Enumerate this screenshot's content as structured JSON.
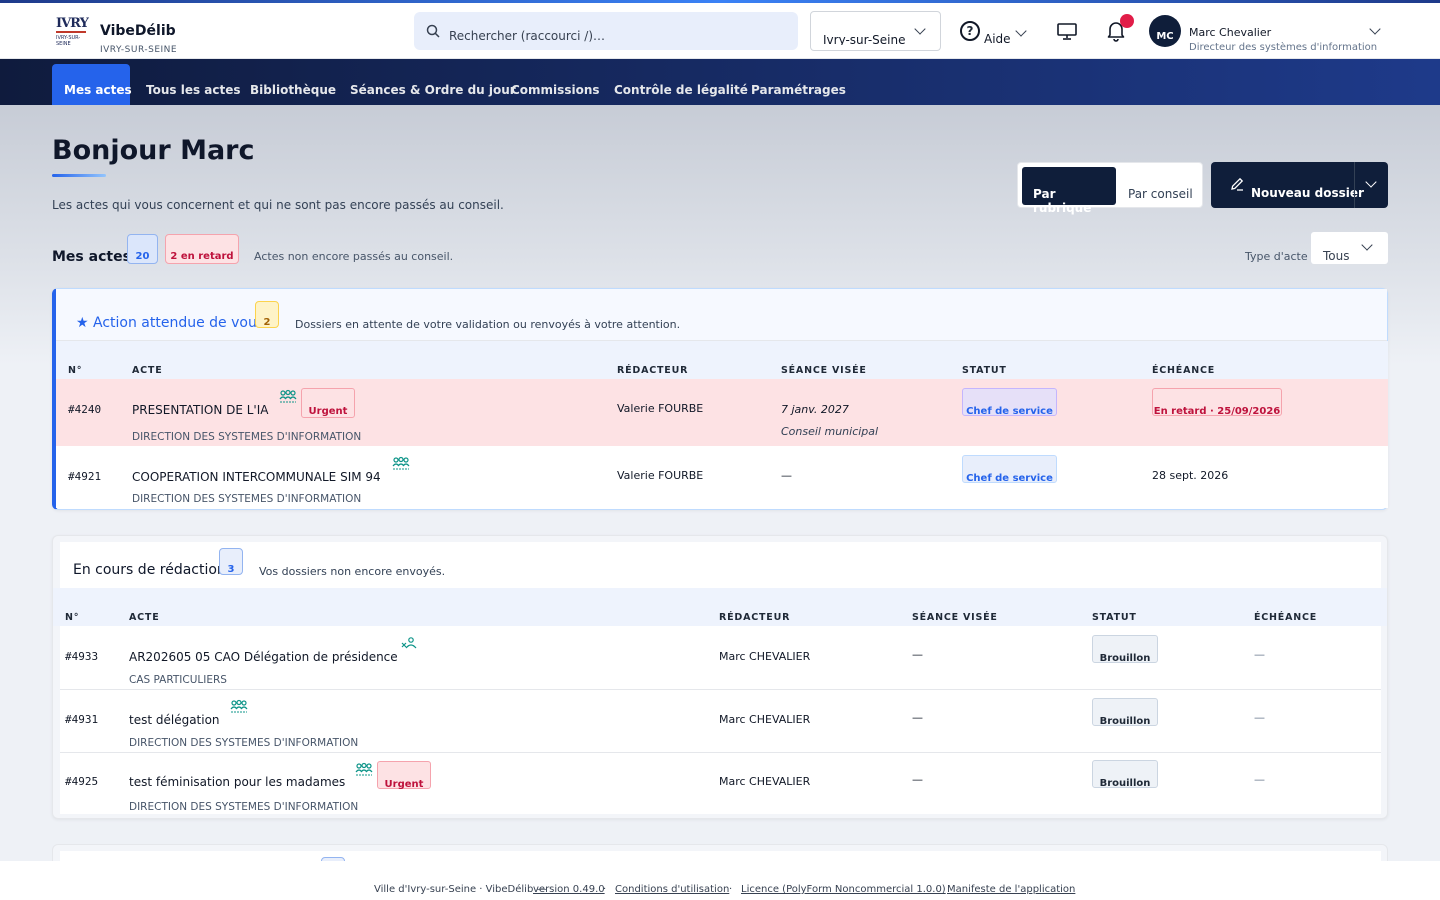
{
  "brand": {
    "logo_top": "IVRY",
    "logo_bottom": "IVRY-SUR-SEINE",
    "name": "VibeDélib",
    "sub": "IVRY-SUR-SEINE"
  },
  "search": {
    "placeholder": "Rechercher (raccourci /)…"
  },
  "city_select": {
    "value": "Ivry-sur-Seine"
  },
  "help": {
    "label": "Aide"
  },
  "user": {
    "initials": "MC",
    "name": "Marc Chevalier",
    "role": "Directeur des systèmes d'information"
  },
  "nav": {
    "items": [
      {
        "label": "Mes actes"
      },
      {
        "label": "Tous les actes"
      },
      {
        "label": "Bibliothèque"
      },
      {
        "label": "Séances & Ordre du jour"
      },
      {
        "label": "Commissions"
      },
      {
        "label": "Contrôle de légalité"
      },
      {
        "label": "Paramétrages"
      }
    ]
  },
  "hero": {
    "greeting": "Bonjour Marc",
    "subtitle": "Les actes qui vous concernent et qui ne sont pas encore passés au conseil.",
    "toggle": {
      "active": "Par rubrique",
      "inactive": "Par conseil"
    },
    "new_button": "Nouveau dossier"
  },
  "mes_actes": {
    "title": "Mes actes",
    "count": "20",
    "late_badge": "2 en retard",
    "subtitle": "Actes non encore passés au conseil.",
    "type_label": "Type d'acte",
    "type_value": "Tous"
  },
  "columns": {
    "num": "N°",
    "acte": "ACTE",
    "redacteur": "RÉDACTEUR",
    "seance": "SÉANCE VISÉE",
    "statut": "STATUT",
    "echeance": "ÉCHÉANCE"
  },
  "action": {
    "title": "★ Action attendue de vous",
    "count": "2",
    "subtitle": "Dossiers en attente de votre validation ou renvoyés à votre attention.",
    "rows": [
      {
        "num": "#4240",
        "title": "PRESENTATION DE L'IA",
        "urgent": "Urgent",
        "service": "DIRECTION DES SYSTEMES D'INFORMATION",
        "redacteur": "Valerie FOURBE",
        "seance_date": "7 janv. 2027",
        "seance_name": "Conseil municipal",
        "statut": "Chef de service",
        "echeance": "En retard · 25/09/2026"
      },
      {
        "num": "#4921",
        "title": "COOPERATION INTERCOMMUNALE SIM 94",
        "service": "DIRECTION DES SYSTEMES D'INFORMATION",
        "redacteur": "Valerie FOURBE",
        "seance_date": "—",
        "statut": "Chef de service",
        "echeance": "28 sept. 2026"
      }
    ]
  },
  "redaction": {
    "title": "En cours de rédaction",
    "count": "3",
    "subtitle": "Vos dossiers non encore envoyés.",
    "rows": [
      {
        "num": "#4933",
        "title": "AR202605 05 CAO Délégation de présidence",
        "service": "CAS PARTICULIERS",
        "redacteur": "Marc CHEVALIER",
        "seance": "—",
        "statut": "Brouillon",
        "echeance": "—"
      },
      {
        "num": "#4931",
        "title": "test délégation",
        "service": "DIRECTION DES SYSTEMES D'INFORMATION",
        "redacteur": "Marc CHEVALIER",
        "seance": "—",
        "statut": "Brouillon",
        "echeance": "—"
      },
      {
        "num": "#4925",
        "title": "test féminisation pour les madames",
        "urgent": "Urgent",
        "service": "DIRECTION DES SYSTEMES D'INFORMATION",
        "redacteur": "Marc CHEVALIER",
        "seance": "—",
        "statut": "Brouillon",
        "echeance": "—"
      }
    ]
  },
  "footer": {
    "text": "Ville d'Ivry-sur-Seine · VibeDélib —",
    "version": "version 0.49.0",
    "sep": "·",
    "cgu": "Conditions d'utilisation",
    "licence": "Licence (PolyForm Noncommercial 1.0.0)",
    "manifeste": "Manifeste de l'application"
  },
  "colors": {
    "accent": "#2563eb",
    "navy": "#0f1e3a",
    "urgent": "#be123c",
    "late_row": "#fde2e4"
  }
}
